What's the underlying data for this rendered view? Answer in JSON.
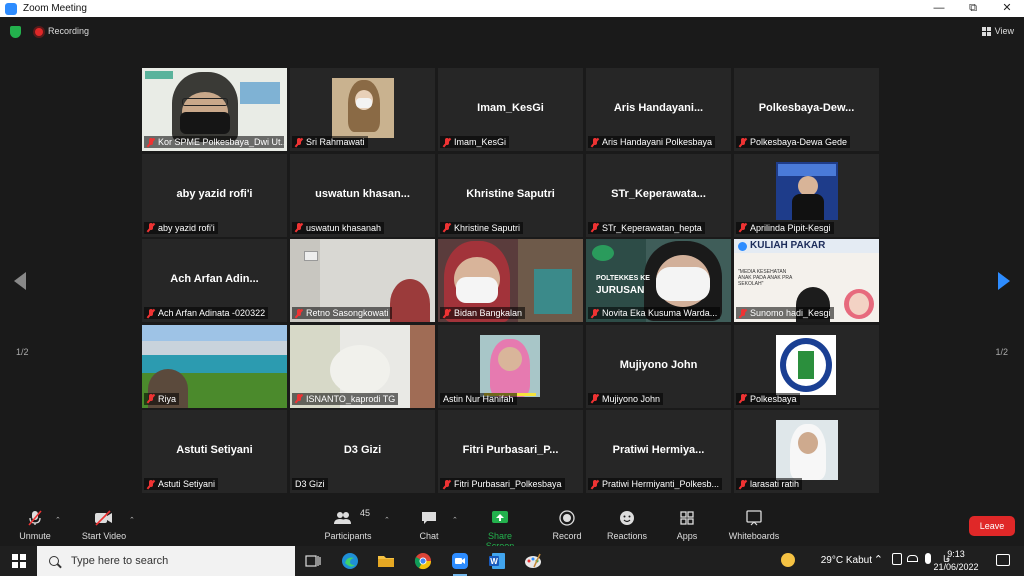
{
  "window": {
    "title": "Zoom Meeting"
  },
  "topbar": {
    "recording_label": "Recording",
    "view_label": "View"
  },
  "pager": {
    "left": "1/2",
    "right": "1/2"
  },
  "tiles": [
    {
      "type": "video",
      "scene": "speaker",
      "label": "Kor SPME Polkesbaya_Dwi Ut...",
      "active": true
    },
    {
      "type": "video",
      "scene": "hijab-small",
      "label": "Sri Rahmawati"
    },
    {
      "type": "name",
      "center": "Imam_KesGi",
      "label": "Imam_KesGi"
    },
    {
      "type": "name",
      "center": "Aris  Handayani...",
      "label": "Aris Handayani Polkesbaya"
    },
    {
      "type": "name",
      "center": "Polkesbaya-Dew...",
      "label": "Polkesbaya-Dewa Gede"
    },
    {
      "type": "name",
      "center": "aby yazid rofi'i",
      "label": "aby yazid rofi'i"
    },
    {
      "type": "name",
      "center": "uswatun  khasan...",
      "label": "uswatun khasanah"
    },
    {
      "type": "name",
      "center": "Khristine Saputri",
      "label": "Khristine Saputri"
    },
    {
      "type": "name",
      "center": "STr_Keperawata...",
      "label": "STr_Keperawatan_hepta"
    },
    {
      "type": "video",
      "scene": "presenter",
      "label": "Aprilinda Pipit-Kesgi"
    },
    {
      "type": "name",
      "center": "Ach Arfan Adin...",
      "label": "Ach Arfan Adinata -020322"
    },
    {
      "type": "video",
      "scene": "wall",
      "label": "Retno Sasongkowati"
    },
    {
      "type": "video",
      "scene": "mask-room",
      "label": "Bidan Bangkalan"
    },
    {
      "type": "video",
      "scene": "mask-banner",
      "label": "Novita Eka Kusuma Warda..."
    },
    {
      "type": "video",
      "scene": "poster",
      "label": "Sunomo hadi_Kesgi"
    },
    {
      "type": "video",
      "scene": "lake",
      "label": "Riya"
    },
    {
      "type": "video",
      "scene": "blur",
      "label": "ISNANTO_kaprodi TG"
    },
    {
      "type": "video",
      "scene": "hijab-pink",
      "label": "Astin Nur Hanifah",
      "nomic": true,
      "speaking": true
    },
    {
      "type": "name",
      "center": "Mujiyono John",
      "label": "Mujiyono John"
    },
    {
      "type": "video",
      "scene": "logo",
      "label": "Polkesbaya"
    },
    {
      "type": "name",
      "center": "Astuti Setiyani",
      "label": "Astuti Setiyani"
    },
    {
      "type": "name",
      "center": "D3 Gizi",
      "label": "D3 Gizi",
      "nomic": true
    },
    {
      "type": "name",
      "center": "Fitri  Purbasari_P...",
      "label": "Fitri Purbasari_Polkesbaya"
    },
    {
      "type": "name",
      "center": "Pratiwi  Hermiya...",
      "label": "Pratiwi Hermiyanti_Polkesb..."
    },
    {
      "type": "video",
      "scene": "hijab-white",
      "label": "larasati ratih"
    }
  ],
  "poster": {
    "headline": "KULIAH PAKAR",
    "subtitle": "\"MEDIA KESEHATAN ANAK PADA ANAK PRA SEKOLAH\""
  },
  "banner": {
    "line1": "POLTEKKES KE",
    "line2": "JURUSAN"
  },
  "toolbar": {
    "unmute": "Unmute",
    "start_video": "Start Video",
    "participants": "Participants",
    "participants_count": "45",
    "chat": "Chat",
    "share_screen": "Share Screen",
    "record": "Record",
    "reactions": "Reactions",
    "apps": "Apps",
    "whiteboards": "Whiteboards",
    "leave": "Leave"
  },
  "taskbar": {
    "search_placeholder": "Type here to search",
    "weather": "29°C  Kabut",
    "time": "9:13",
    "date": "21/06/2022"
  },
  "colors": {
    "accent": "#2d8cff",
    "leave": "#e02828",
    "share": "#23b14d",
    "active_border": "#c7e84b"
  }
}
